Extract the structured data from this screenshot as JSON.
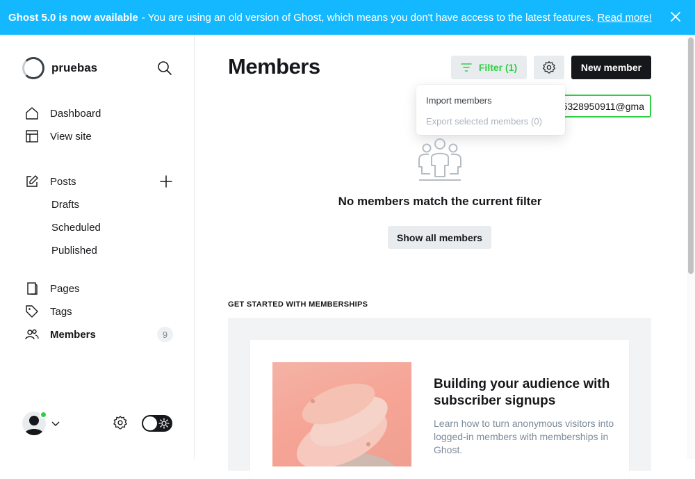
{
  "banner": {
    "strong": "Ghost 5.0 is now available",
    "message": "- You are using an old version of Ghost, which means you don't have access to the latest features.",
    "link": "Read more!"
  },
  "sidebar": {
    "site_name": "pruebas",
    "nav": {
      "dashboard": "Dashboard",
      "view_site": "View site",
      "posts": "Posts",
      "drafts": "Drafts",
      "scheduled": "Scheduled",
      "published": "Published",
      "pages": "Pages",
      "tags": "Tags",
      "members": "Members",
      "members_count": "9"
    }
  },
  "main": {
    "title": "Members",
    "filter_label": "Filter (1)",
    "new_member_label": "New member",
    "search_value": "5328950911@gma",
    "dropdown": {
      "import": "Import members",
      "export": "Export selected members (0)"
    },
    "empty_title": "No members match the current filter",
    "show_all_label": "Show all members",
    "section_label": "GET STARTED WITH MEMBERSHIPS",
    "promo": {
      "title": "Building your audience with subscriber signups",
      "description": "Learn how to turn anonymous visitors into logged-in members with memberships in Ghost."
    }
  },
  "colors": {
    "banner": "#14b8ff",
    "accent_green": "#30cf43",
    "dark": "#15171a"
  }
}
